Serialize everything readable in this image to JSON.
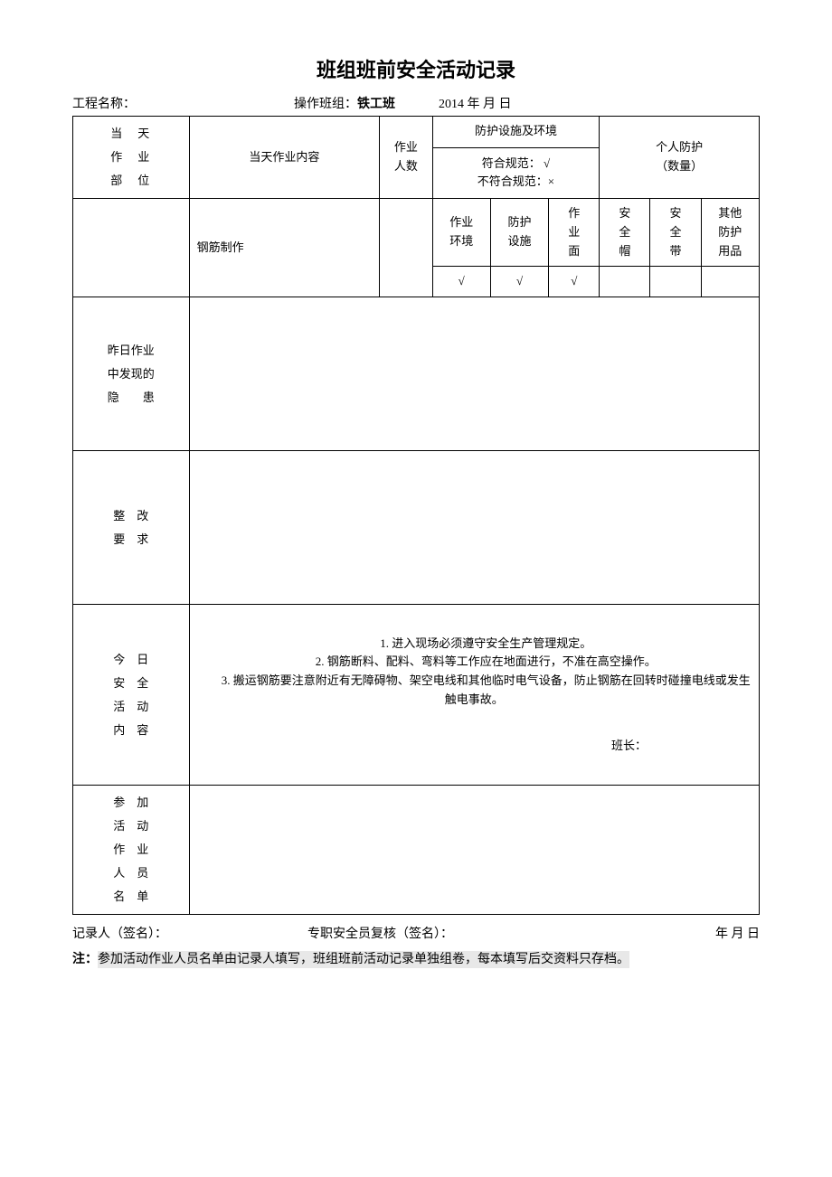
{
  "title": "班组班前安全活动记录",
  "meta": {
    "projectLabel": "工程名称：",
    "teamLabel": "操作班组：",
    "teamValue": "铁工班",
    "dateText": "2014 年    月    日"
  },
  "headers": {
    "col1": "当　天\n作　业\n部　位",
    "col2": "当天作业内容",
    "col3": "作业\n人数",
    "protGroup": "防护设施及环境",
    "protSpec": "符合规范： √\n不符合规范：×",
    "ppeGroup": "个人防护\n（数量）",
    "sub": {
      "env": "作业\n环境",
      "fac": "防护\n设施",
      "face": "作\n业\n面",
      "helmet": "安\n全\n帽",
      "belt": "安\n全\n带",
      "other": "其他\n防护\n用品"
    }
  },
  "dataRow": {
    "workContent": "钢筋制作",
    "envMark": "√",
    "facMark": "√",
    "faceMark": "√"
  },
  "rows": {
    "hazard": "昨日作业\n中发现的\n隐　　患",
    "rectify": "整　改\n要　求",
    "todayLabel": "今　日\n安　全\n活　动\n内　容",
    "todayContent": "　　1. 进入现场必须遵守安全生产管理规定。\n　　2. 钢筋断料、配料、弯料等工作应在地面进行，不准在高空操作。\n　　3. 搬运钢筋要注意附近有无障碍物、架空电线和其他临时电气设备，防止钢筋在回转时碰撞电线或发生触电事故。",
    "leader": "班长：",
    "attendees": "参　加\n活　动\n作　业\n人　员\n名　单"
  },
  "footer": {
    "recorder": "记录人（签名）：",
    "reviewer": "专职安全员复核（签名）：",
    "dateText": "年    月    日"
  },
  "note": {
    "label": "注：",
    "text": "参加活动作业人员名单由记录人填写，班组班前活动记录单独组卷，每本填写后交资料只存档。"
  }
}
